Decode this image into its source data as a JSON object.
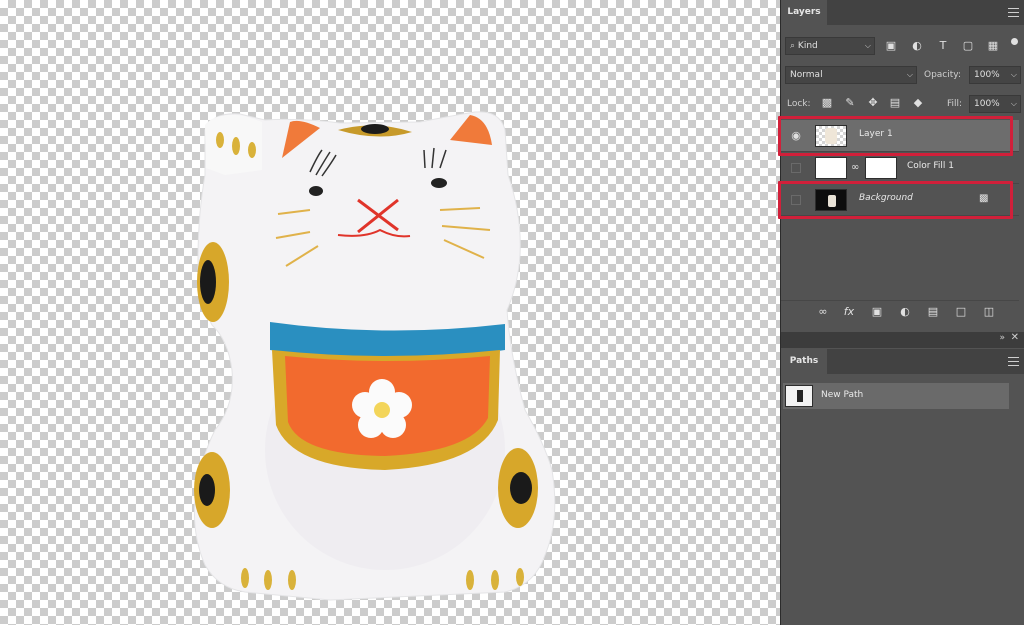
{
  "layers_panel": {
    "tab": "Layers",
    "filter": {
      "value": "Kind"
    },
    "blend_mode": {
      "value": "Normal"
    },
    "opacity": {
      "label": "Opacity:",
      "value": "100%"
    },
    "lock": {
      "label": "Lock:"
    },
    "fill": {
      "label": "Fill:",
      "value": "100%"
    },
    "layers": [
      {
        "name": "Layer 1",
        "visible": true,
        "selected": true,
        "highlighted": true
      },
      {
        "name": "Color Fill 1",
        "visible": false,
        "selected": false,
        "highlighted": false
      },
      {
        "name": "Background",
        "visible": false,
        "selected": false,
        "highlighted": true,
        "locked": true
      }
    ]
  },
  "paths_panel": {
    "tab": "Paths",
    "paths": [
      {
        "name": "New Path"
      }
    ]
  },
  "colors": {
    "panel": "#535353",
    "highlight": "#d1203a",
    "selected_row": "#6d6d6d"
  }
}
